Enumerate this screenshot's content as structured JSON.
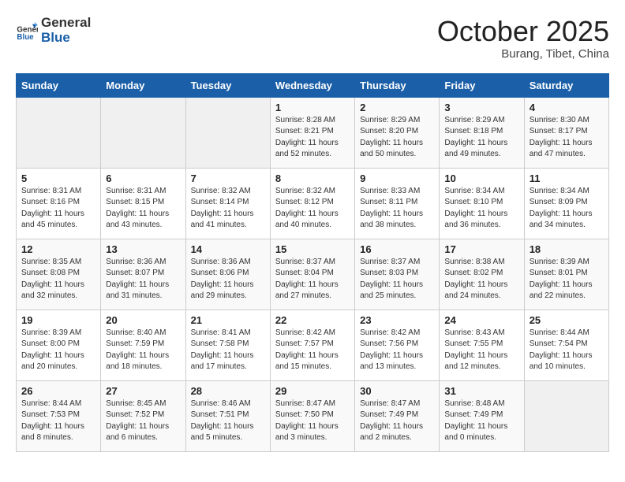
{
  "header": {
    "logo_general": "General",
    "logo_blue": "Blue",
    "month": "October 2025",
    "location": "Burang, Tibet, China"
  },
  "weekdays": [
    "Sunday",
    "Monday",
    "Tuesday",
    "Wednesday",
    "Thursday",
    "Friday",
    "Saturday"
  ],
  "weeks": [
    [
      {
        "day": "",
        "info": ""
      },
      {
        "day": "",
        "info": ""
      },
      {
        "day": "",
        "info": ""
      },
      {
        "day": "1",
        "info": "Sunrise: 8:28 AM\nSunset: 8:21 PM\nDaylight: 11 hours\nand 52 minutes."
      },
      {
        "day": "2",
        "info": "Sunrise: 8:29 AM\nSunset: 8:20 PM\nDaylight: 11 hours\nand 50 minutes."
      },
      {
        "day": "3",
        "info": "Sunrise: 8:29 AM\nSunset: 8:18 PM\nDaylight: 11 hours\nand 49 minutes."
      },
      {
        "day": "4",
        "info": "Sunrise: 8:30 AM\nSunset: 8:17 PM\nDaylight: 11 hours\nand 47 minutes."
      }
    ],
    [
      {
        "day": "5",
        "info": "Sunrise: 8:31 AM\nSunset: 8:16 PM\nDaylight: 11 hours\nand 45 minutes."
      },
      {
        "day": "6",
        "info": "Sunrise: 8:31 AM\nSunset: 8:15 PM\nDaylight: 11 hours\nand 43 minutes."
      },
      {
        "day": "7",
        "info": "Sunrise: 8:32 AM\nSunset: 8:14 PM\nDaylight: 11 hours\nand 41 minutes."
      },
      {
        "day": "8",
        "info": "Sunrise: 8:32 AM\nSunset: 8:12 PM\nDaylight: 11 hours\nand 40 minutes."
      },
      {
        "day": "9",
        "info": "Sunrise: 8:33 AM\nSunset: 8:11 PM\nDaylight: 11 hours\nand 38 minutes."
      },
      {
        "day": "10",
        "info": "Sunrise: 8:34 AM\nSunset: 8:10 PM\nDaylight: 11 hours\nand 36 minutes."
      },
      {
        "day": "11",
        "info": "Sunrise: 8:34 AM\nSunset: 8:09 PM\nDaylight: 11 hours\nand 34 minutes."
      }
    ],
    [
      {
        "day": "12",
        "info": "Sunrise: 8:35 AM\nSunset: 8:08 PM\nDaylight: 11 hours\nand 32 minutes."
      },
      {
        "day": "13",
        "info": "Sunrise: 8:36 AM\nSunset: 8:07 PM\nDaylight: 11 hours\nand 31 minutes."
      },
      {
        "day": "14",
        "info": "Sunrise: 8:36 AM\nSunset: 8:06 PM\nDaylight: 11 hours\nand 29 minutes."
      },
      {
        "day": "15",
        "info": "Sunrise: 8:37 AM\nSunset: 8:04 PM\nDaylight: 11 hours\nand 27 minutes."
      },
      {
        "day": "16",
        "info": "Sunrise: 8:37 AM\nSunset: 8:03 PM\nDaylight: 11 hours\nand 25 minutes."
      },
      {
        "day": "17",
        "info": "Sunrise: 8:38 AM\nSunset: 8:02 PM\nDaylight: 11 hours\nand 24 minutes."
      },
      {
        "day": "18",
        "info": "Sunrise: 8:39 AM\nSunset: 8:01 PM\nDaylight: 11 hours\nand 22 minutes."
      }
    ],
    [
      {
        "day": "19",
        "info": "Sunrise: 8:39 AM\nSunset: 8:00 PM\nDaylight: 11 hours\nand 20 minutes."
      },
      {
        "day": "20",
        "info": "Sunrise: 8:40 AM\nSunset: 7:59 PM\nDaylight: 11 hours\nand 18 minutes."
      },
      {
        "day": "21",
        "info": "Sunrise: 8:41 AM\nSunset: 7:58 PM\nDaylight: 11 hours\nand 17 minutes."
      },
      {
        "day": "22",
        "info": "Sunrise: 8:42 AM\nSunset: 7:57 PM\nDaylight: 11 hours\nand 15 minutes."
      },
      {
        "day": "23",
        "info": "Sunrise: 8:42 AM\nSunset: 7:56 PM\nDaylight: 11 hours\nand 13 minutes."
      },
      {
        "day": "24",
        "info": "Sunrise: 8:43 AM\nSunset: 7:55 PM\nDaylight: 11 hours\nand 12 minutes."
      },
      {
        "day": "25",
        "info": "Sunrise: 8:44 AM\nSunset: 7:54 PM\nDaylight: 11 hours\nand 10 minutes."
      }
    ],
    [
      {
        "day": "26",
        "info": "Sunrise: 8:44 AM\nSunset: 7:53 PM\nDaylight: 11 hours\nand 8 minutes."
      },
      {
        "day": "27",
        "info": "Sunrise: 8:45 AM\nSunset: 7:52 PM\nDaylight: 11 hours\nand 6 minutes."
      },
      {
        "day": "28",
        "info": "Sunrise: 8:46 AM\nSunset: 7:51 PM\nDaylight: 11 hours\nand 5 minutes."
      },
      {
        "day": "29",
        "info": "Sunrise: 8:47 AM\nSunset: 7:50 PM\nDaylight: 11 hours\nand 3 minutes."
      },
      {
        "day": "30",
        "info": "Sunrise: 8:47 AM\nSunset: 7:49 PM\nDaylight: 11 hours\nand 2 minutes."
      },
      {
        "day": "31",
        "info": "Sunrise: 8:48 AM\nSunset: 7:49 PM\nDaylight: 11 hours\nand 0 minutes."
      },
      {
        "day": "",
        "info": ""
      }
    ]
  ]
}
